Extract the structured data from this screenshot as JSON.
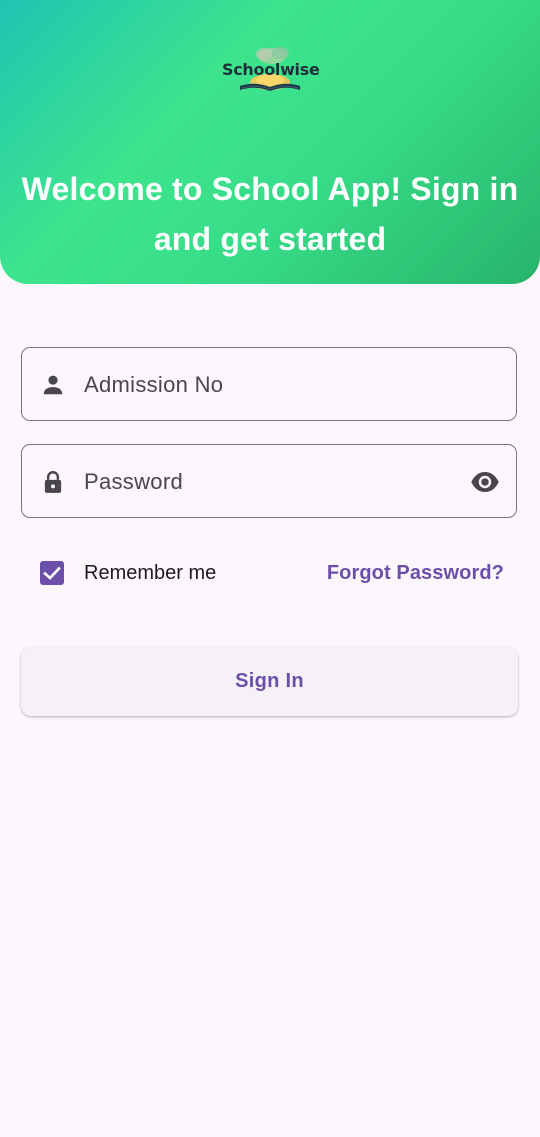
{
  "header": {
    "logo_text": "Schoolwise",
    "welcome_text": "Welcome to School App! Sign in and get started"
  },
  "form": {
    "admission_placeholder": "Admission No",
    "password_placeholder": "Password",
    "remember_label": "Remember me",
    "remember_checked": true,
    "forgot_label": "Forgot Password?",
    "signin_label": "Sign In"
  },
  "icons": {
    "user": "person-icon",
    "password": "lock-icon",
    "visibility": "eye-icon",
    "checkbox": "check-icon"
  },
  "colors": {
    "header_gradient_start": "#1fc4b3",
    "header_gradient_mid": "#3de48d",
    "header_gradient_end": "#27b46a",
    "accent": "#6b4fa9",
    "background": "#fcf6fd"
  }
}
